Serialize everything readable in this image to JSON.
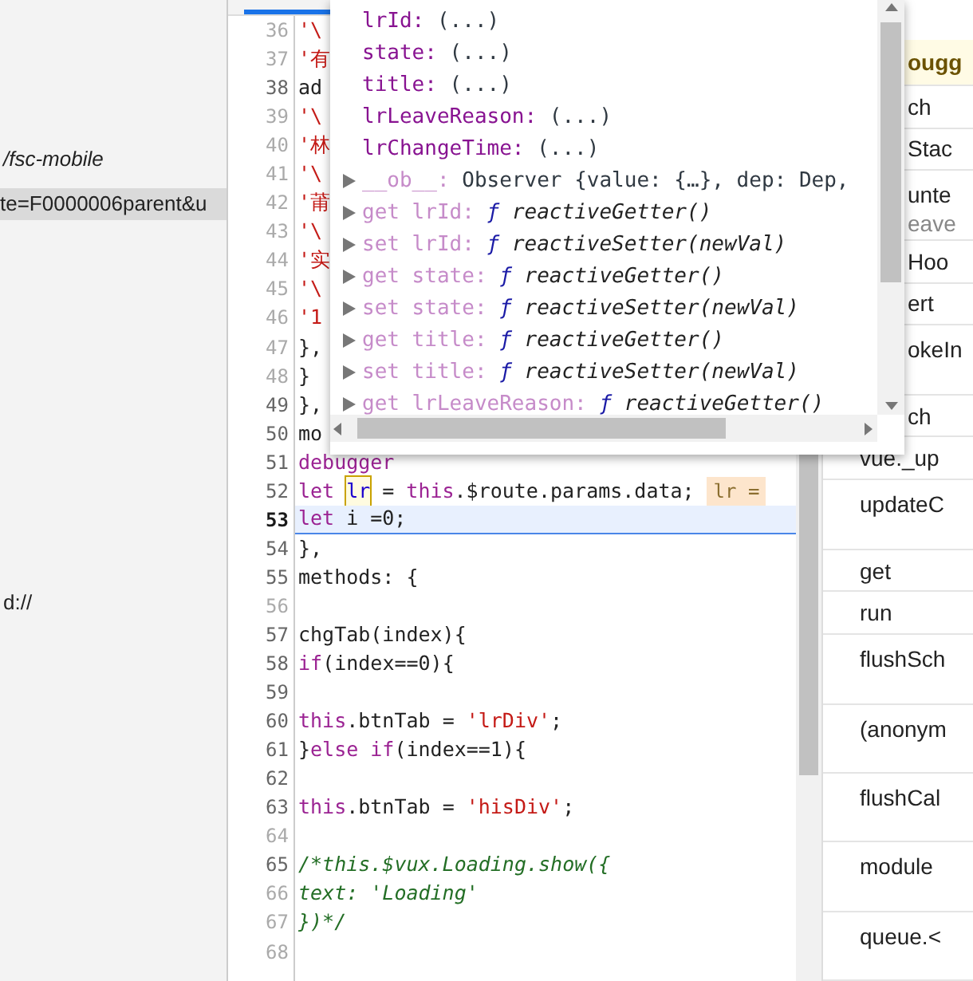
{
  "navigator": {
    "items": [
      {
        "text": "/fsc-mobile",
        "selected": false,
        "italic": true
      },
      {
        "text": "te=F0000006parent&u",
        "selected": true,
        "italic": false
      },
      {
        "text": "d://",
        "selected": false,
        "italic": false
      }
    ]
  },
  "editor": {
    "lines": [
      {
        "number": "36",
        "dim": true,
        "current": false,
        "tokens": [
          {
            "t": "'\\",
            "kind": "str"
          }
        ]
      },
      {
        "number": "37",
        "dim": true,
        "current": false,
        "tokens": [
          {
            "t": "'有",
            "kind": "str"
          }
        ]
      },
      {
        "number": "38",
        "dim": false,
        "current": false,
        "tokens": [
          {
            "t": "ad",
            "kind": "plain"
          }
        ]
      },
      {
        "number": "39",
        "dim": true,
        "current": false,
        "tokens": [
          {
            "t": "'\\",
            "kind": "str"
          }
        ]
      },
      {
        "number": "40",
        "dim": true,
        "current": false,
        "tokens": [
          {
            "t": "'林",
            "kind": "str"
          }
        ]
      },
      {
        "number": "41",
        "dim": true,
        "current": false,
        "tokens": [
          {
            "t": "'\\",
            "kind": "str"
          }
        ]
      },
      {
        "number": "42",
        "dim": true,
        "current": false,
        "tokens": [
          {
            "t": "'莆",
            "kind": "str"
          }
        ]
      },
      {
        "number": "43",
        "dim": true,
        "current": false,
        "tokens": [
          {
            "t": "'\\",
            "kind": "str"
          }
        ]
      },
      {
        "number": "44",
        "dim": true,
        "current": false,
        "tokens": [
          {
            "t": "'实",
            "kind": "str"
          }
        ]
      },
      {
        "number": "45",
        "dim": true,
        "current": false,
        "tokens": [
          {
            "t": "'\\",
            "kind": "str"
          }
        ]
      },
      {
        "number": "46",
        "dim": true,
        "current": false,
        "tokens": [
          {
            "t": "'1",
            "kind": "str"
          }
        ]
      },
      {
        "number": "47",
        "dim": true,
        "current": false,
        "tokens": [
          {
            "t": "},",
            "kind": "plain"
          }
        ]
      },
      {
        "number": "48",
        "dim": true,
        "current": false,
        "tokens": [
          {
            "t": "}",
            "kind": "plain"
          }
        ]
      },
      {
        "number": "49",
        "dim": false,
        "current": false,
        "tokens": [
          {
            "t": "},",
            "kind": "plain"
          }
        ]
      },
      {
        "number": "50",
        "dim": false,
        "current": false,
        "tokens": [
          {
            "t": "mo",
            "kind": "plain"
          }
        ]
      },
      {
        "number": "51",
        "dim": false,
        "current": false,
        "tokens": [
          {
            "t": "debugger",
            "kind": "kw"
          }
        ]
      },
      {
        "number": "52",
        "dim": false,
        "current": false,
        "tokens": [
          {
            "t": "let",
            "kind": "kw"
          },
          {
            "t": "lr",
            "kind": "boxed"
          },
          {
            "t": "=",
            "kind": "plain"
          },
          {
            "t": "this",
            "kind": "kw"
          },
          {
            "t": ".$route.params.data;",
            "kind": "plain"
          },
          {
            "t": "lr =",
            "kind": "inline"
          }
        ]
      },
      {
        "number": "53",
        "dim": false,
        "current": true,
        "tokens": [
          {
            "t": "let",
            "kind": "kw"
          },
          {
            "t": "i =0;",
            "kind": "plain"
          }
        ]
      },
      {
        "number": "54",
        "dim": false,
        "current": false,
        "tokens": [
          {
            "t": "},",
            "kind": "plain"
          }
        ]
      },
      {
        "number": "55",
        "dim": false,
        "current": false,
        "tokens": [
          {
            "t": "methods: {",
            "kind": "plain"
          }
        ]
      },
      {
        "number": "56",
        "dim": true,
        "current": false
      },
      {
        "number": "57",
        "dim": false,
        "current": false,
        "tokens": [
          {
            "t": "chgTab(index){",
            "kind": "plain"
          }
        ]
      },
      {
        "number": "58",
        "dim": false,
        "current": false,
        "tokens": [
          {
            "t": "if",
            "kind": "kw"
          },
          {
            "t": "(index==0){",
            "kind": "plain"
          }
        ]
      },
      {
        "number": "59",
        "dim": false,
        "current": false
      },
      {
        "number": "60",
        "dim": false,
        "current": false,
        "tokens": [
          {
            "t": "this",
            "kind": "kw"
          },
          {
            "t": ".btnTab =",
            "kind": "plain"
          },
          {
            "t": "'lrDiv'",
            "kind": "str"
          },
          {
            "t": ";",
            "kind": "plain"
          }
        ]
      },
      {
        "number": "61",
        "dim": false,
        "current": false,
        "tokens": [
          {
            "t": "}",
            "kind": "plain"
          },
          {
            "t": "else if",
            "kind": "kw"
          },
          {
            "t": "(index==1){",
            "kind": "plain"
          }
        ]
      },
      {
        "number": "62",
        "dim": false,
        "current": false
      },
      {
        "number": "63",
        "dim": false,
        "current": false,
        "tokens": [
          {
            "t": "this",
            "kind": "kw"
          },
          {
            "t": ".btnTab =",
            "kind": "plain"
          },
          {
            "t": "'hisDiv'",
            "kind": "str"
          },
          {
            "t": ";",
            "kind": "plain"
          }
        ]
      },
      {
        "number": "64",
        "dim": true,
        "current": false
      },
      {
        "number": "65",
        "dim": false,
        "current": false,
        "tokens": [
          {
            "t": "/*this.$vux.Loading.show({",
            "kind": "cmt"
          }
        ]
      },
      {
        "number": "66",
        "dim": true,
        "current": false,
        "tokens": [
          {
            "t": "text: 'Loading'",
            "kind": "cmt"
          }
        ]
      },
      {
        "number": "67",
        "dim": true,
        "current": false,
        "tokens": [
          {
            "t": "})*/",
            "kind": "cmt"
          }
        ]
      },
      {
        "number": "68",
        "dim": true,
        "current": false
      }
    ]
  },
  "popover": {
    "entries": [
      {
        "name": "lrId:",
        "value": "(...)",
        "expandable": false,
        "dim": false,
        "kind": "prop"
      },
      {
        "name": "state:",
        "value": "(...)",
        "expandable": false,
        "dim": false,
        "kind": "prop"
      },
      {
        "name": "title:",
        "value": "(...)",
        "expandable": false,
        "dim": false,
        "kind": "prop"
      },
      {
        "name": "lrLeaveReason:",
        "value": "(...)",
        "expandable": false,
        "dim": false,
        "kind": "prop"
      },
      {
        "name": "lrChangeTime:",
        "value": "(...)",
        "expandable": false,
        "dim": false,
        "kind": "prop"
      },
      {
        "name": "__ob__:",
        "value": "Observer {value: {…}, dep: Dep,",
        "expandable": true,
        "dim": true,
        "kind": "prop"
      },
      {
        "name": "get lrId:",
        "mark": "ƒ",
        "value": "reactiveGetter()",
        "expandable": true,
        "dim": true,
        "kind": "func"
      },
      {
        "name": "set lrId:",
        "mark": "ƒ",
        "value": "reactiveSetter(newVal)",
        "expandable": true,
        "dim": true,
        "kind": "func"
      },
      {
        "name": "get state:",
        "mark": "ƒ",
        "value": "reactiveGetter()",
        "expandable": true,
        "dim": true,
        "kind": "func"
      },
      {
        "name": "set state:",
        "mark": "ƒ",
        "value": "reactiveSetter(newVal)",
        "expandable": true,
        "dim": true,
        "kind": "func"
      },
      {
        "name": "get title:",
        "mark": "ƒ",
        "value": "reactiveGetter()",
        "expandable": true,
        "dim": true,
        "kind": "func"
      },
      {
        "name": "set title:",
        "mark": "ƒ",
        "value": "reactiveSetter(newVal)",
        "expandable": true,
        "dim": true,
        "kind": "func"
      },
      {
        "name": "get lrLeaveReason:",
        "mark": "ƒ",
        "value": "reactiveGetter()",
        "expandable": true,
        "dim": true,
        "kind": "func"
      }
    ]
  },
  "sidebar": {
    "rows": [
      {
        "lines": [
          "ougg"
        ],
        "kind": "banner"
      },
      {
        "lines": [
          "ch"
        ],
        "kind": "short"
      },
      {
        "lines": [
          "Stac"
        ],
        "kind": "short"
      },
      {
        "lines": [
          "unte",
          "eave"
        ],
        "kind": "tall"
      },
      {
        "lines": [
          "Hoo"
        ],
        "kind": "short"
      },
      {
        "lines": [
          "ert"
        ],
        "kind": "short"
      },
      {
        "lines": [
          "okeIn"
        ],
        "kind": "tall"
      },
      {
        "lines": [
          "ch"
        ],
        "kind": "short"
      },
      {
        "lines": [
          "vue._up"
        ],
        "kind": "short"
      },
      {
        "lines": [
          "updateC"
        ],
        "kind": "tall"
      },
      {
        "lines": [
          "get"
        ],
        "kind": "short"
      },
      {
        "lines": [
          "run"
        ],
        "kind": "short"
      },
      {
        "lines": [
          "flushSch"
        ],
        "kind": "tall"
      },
      {
        "lines": [
          "(anonym"
        ],
        "kind": "tall"
      },
      {
        "lines": [
          "flushCal"
        ],
        "kind": "tall"
      },
      {
        "lines": [
          "module"
        ],
        "kind": "tall"
      },
      {
        "lines": [
          "queue.<"
        ],
        "kind": "tall"
      }
    ]
  }
}
